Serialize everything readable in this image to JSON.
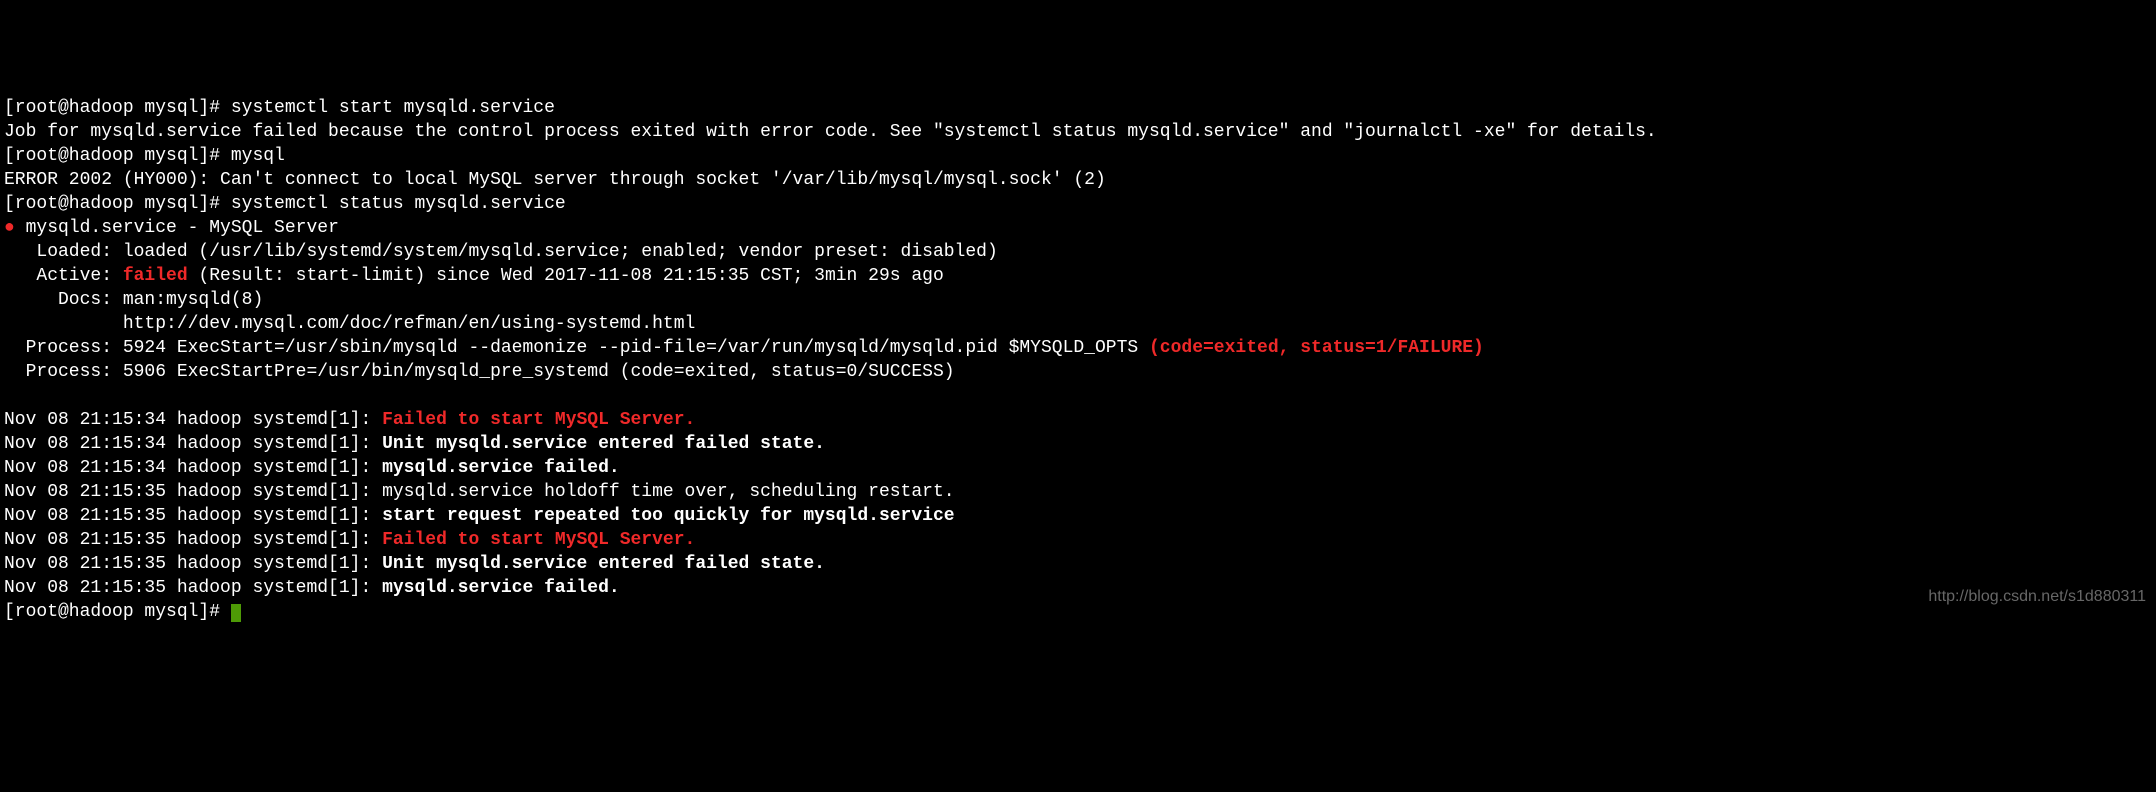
{
  "prompt1": "[root@hadoop mysql]# ",
  "cmd1": "systemctl start mysqld.service",
  "out1": "Job for mysqld.service failed because the control process exited with error code. See \"systemctl status mysqld.service\" and \"journalctl -xe\" for details.",
  "prompt2": "[root@hadoop mysql]# ",
  "cmd2": "mysql",
  "out2": "ERROR 2002 (HY000): Can't connect to local MySQL server through socket '/var/lib/mysql/mysql.sock' (2)",
  "prompt3": "[root@hadoop mysql]# ",
  "cmd3": "systemctl status mysqld.service",
  "status_bullet": "●",
  "status_header": " mysqld.service - MySQL Server",
  "status_loaded": "   Loaded: loaded (/usr/lib/systemd/system/mysqld.service; enabled; vendor preset: disabled)",
  "status_active_label": "   Active: ",
  "status_active_value": "failed",
  "status_active_rest": " (Result: start-limit) since Wed 2017-11-08 21:15:35 CST; 3min 29s ago",
  "status_docs": "     Docs: man:mysqld(8)",
  "status_docs2": "           http://dev.mysql.com/doc/refman/en/using-systemd.html",
  "status_proc1_pre": "  Process: 5924 ExecStart=/usr/sbin/mysqld --daemonize --pid-file=/var/run/mysqld/mysqld.pid $MYSQLD_OPTS ",
  "status_proc1_red": "(code=exited, status=1/FAILURE)",
  "status_proc2": "  Process: 5906 ExecStartPre=/usr/bin/mysqld_pre_systemd (code=exited, status=0/SUCCESS)",
  "blank": "",
  "log1_pre": "Nov 08 21:15:34 hadoop systemd[1]: ",
  "log1_msg": "Failed to start MySQL Server.",
  "log2_pre": "Nov 08 21:15:34 hadoop systemd[1]: ",
  "log2_msg": "Unit mysqld.service entered failed state.",
  "log3_pre": "Nov 08 21:15:34 hadoop systemd[1]: ",
  "log3_msg": "mysqld.service failed.",
  "log4_pre": "Nov 08 21:15:35 hadoop systemd[1]: ",
  "log4_msg": "mysqld.service holdoff time over, scheduling restart.",
  "log5_pre": "Nov 08 21:15:35 hadoop systemd[1]: ",
  "log5_msg": "start request repeated too quickly for mysqld.service",
  "log6_pre": "Nov 08 21:15:35 hadoop systemd[1]: ",
  "log6_msg": "Failed to start MySQL Server.",
  "log7_pre": "Nov 08 21:15:35 hadoop systemd[1]: ",
  "log7_msg": "Unit mysqld.service entered failed state.",
  "log8_pre": "Nov 08 21:15:35 hadoop systemd[1]: ",
  "log8_msg": "mysqld.service failed.",
  "prompt4": "[root@hadoop mysql]# ",
  "watermark": "http://blog.csdn.net/s1d880311"
}
